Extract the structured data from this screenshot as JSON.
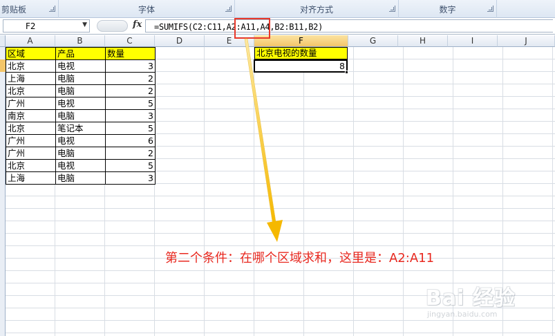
{
  "ribbon": {
    "groups": [
      "剪贴板",
      "字体",
      "对齐方式",
      "数字",
      ""
    ]
  },
  "formula_bar": {
    "name_box": "F2",
    "fx": "fx",
    "formula": "=SUMIFS(C2:C11,A2:A11,A4,B2:B11,B2)"
  },
  "grid": {
    "columns": [
      "A",
      "B",
      "C",
      "D",
      "E",
      "F",
      "G",
      "H",
      "I",
      "J"
    ],
    "selected_column": "F",
    "selected_row": 2
  },
  "table": {
    "headers": [
      "区域",
      "产品",
      "数量"
    ],
    "rows": [
      [
        "北京",
        "电视",
        "3"
      ],
      [
        "上海",
        "电脑",
        "2"
      ],
      [
        "北京",
        "电脑",
        "2"
      ],
      [
        "广州",
        "电视",
        "5"
      ],
      [
        "南京",
        "电脑",
        "3"
      ],
      [
        "北京",
        "笔记本",
        "5"
      ],
      [
        "广州",
        "电视",
        "6"
      ],
      [
        "广州",
        "电脑",
        "2"
      ],
      [
        "北京",
        "电视",
        "5"
      ],
      [
        "上海",
        "电脑",
        "3"
      ]
    ]
  },
  "result": {
    "label": "北京电视的数量",
    "value": "8"
  },
  "annotation": "第二个条件：在哪个区域求和，这里是：A2:A11",
  "watermark": {
    "brand": "Bai 经验",
    "url": "jingyan.baidu.com"
  },
  "colors": {
    "header_fill": "#ffff00",
    "annotation": "#e8281f",
    "arrow": "#f5b800",
    "highlight": "#e8372a"
  }
}
